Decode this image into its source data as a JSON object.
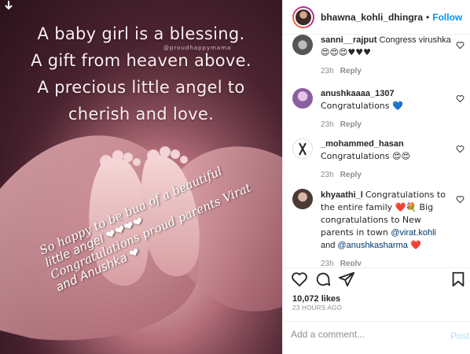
{
  "image": {
    "quote_lines": [
      "A baby girl is a blessing.",
      "A gift from heaven above.",
      "A precious little angel to",
      "cherish and love."
    ],
    "watermark": "@proudhappymama",
    "caption_lines": [
      "So happy to be bua of a beautiful",
      "little angel ❤❤❤❤",
      "Congratulations proud parents Virat",
      "and Anushka ❤"
    ]
  },
  "header": {
    "username": "bhawna_kohli_dhingra",
    "separator": "•",
    "follow_label": "Follow"
  },
  "comments": [
    {
      "user": "sanni__rajput",
      "text": "Congress virushka",
      "emoji": "😍😍😍♥♥♥",
      "time": "23h",
      "reply": "Reply"
    },
    {
      "user": "anushkaaaa_1307",
      "text": "Congratulations 💙",
      "time": "23h",
      "reply": "Reply"
    },
    {
      "user": "_mohammed_hasan",
      "text": "Congratulations 😍😍",
      "time": "23h",
      "reply": "Reply"
    },
    {
      "user": "khyaathi_l",
      "text": "Congratulations to the entire family ❤️💐 Big congratulations to New parents in town ",
      "mention1": "@virat.kohli",
      "and": " and ",
      "mention2": "@anushkasharma",
      "tail": " ❤️",
      "time": "23h",
      "reply": "Reply"
    }
  ],
  "likes": "10,072 likes",
  "posted": "23 HOURS AGO",
  "add_comment": {
    "placeholder": "Add a comment...",
    "post_label": "Post"
  },
  "colors": {
    "accent": "#0095f6",
    "text": "#262626",
    "muted": "#8e8e8e"
  },
  "icons": [
    "down-arrow-icon",
    "heart-icon",
    "comment-icon",
    "share-icon",
    "bookmark-icon"
  ]
}
